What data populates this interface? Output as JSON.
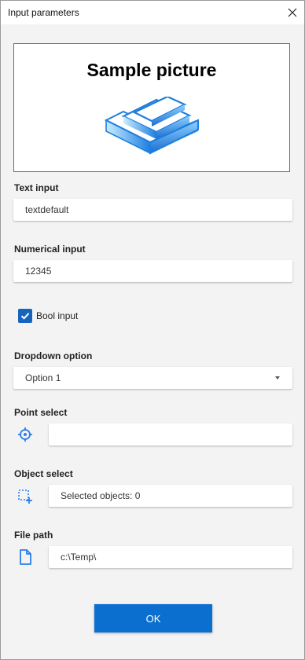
{
  "window": {
    "title": "Input parameters"
  },
  "preview": {
    "title": "Sample picture"
  },
  "text_input": {
    "label": "Text input",
    "value": "textdefault"
  },
  "numerical_input": {
    "label": "Numerical input",
    "value": "12345"
  },
  "bool_input": {
    "label": "Bool input",
    "checked": true
  },
  "dropdown": {
    "label": "Dropdown option",
    "selected": "Option 1"
  },
  "point_select": {
    "label": "Point select",
    "value": "",
    "icon": "crosshair-icon"
  },
  "object_select": {
    "label": "Object select",
    "value": "Selected objects: 0",
    "icon": "select-add-icon"
  },
  "file_path": {
    "label": "File path",
    "value": "c:\\Temp\\",
    "icon": "file-icon"
  },
  "ok_button": {
    "label": "OK"
  },
  "colors": {
    "accent": "#0a6fcf",
    "checkbox": "#1565c0",
    "icon_blue": "#2b7de9",
    "frame": "#2d7fb4"
  }
}
